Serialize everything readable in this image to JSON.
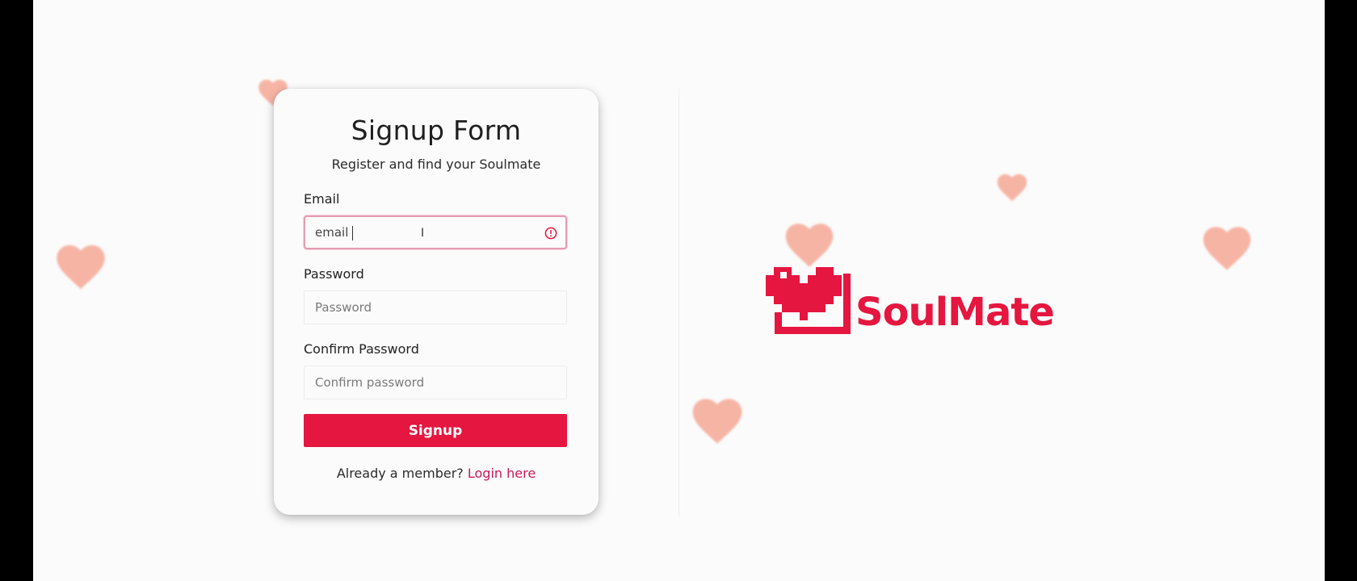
{
  "form": {
    "title": "Signup Form",
    "subtitle": "Register and find your Soulmate",
    "email": {
      "label": "Email",
      "value": "email",
      "placeholder": "Email",
      "state": "invalid"
    },
    "password": {
      "label": "Password",
      "placeholder": "Password"
    },
    "confirm_password": {
      "label": "Confirm Password",
      "placeholder": "Confirm password"
    },
    "submit_label": "Signup",
    "footer_text": "Already a member?",
    "login_link": "Login here"
  },
  "brand": {
    "name": "SoulMate",
    "color": "#e5163f"
  },
  "colors": {
    "accent": "#e5163f",
    "link": "#c9185b",
    "heart": "#f6a896",
    "invalid_border": "#e59bb0"
  },
  "icons": {
    "alert": "alert-circle-icon",
    "cursor": "text-cursor-icon",
    "decorations": "heart-icon"
  }
}
